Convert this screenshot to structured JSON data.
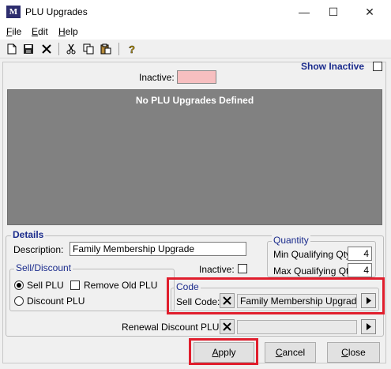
{
  "window": {
    "title": "PLU Upgrades",
    "icon_text": "M",
    "controls": {
      "minimize": "—",
      "maximize": "☐",
      "close": "✕"
    }
  },
  "menu": {
    "items": [
      {
        "label": "File",
        "accel": "F",
        "rest": "ile"
      },
      {
        "label": "Edit",
        "accel": "E",
        "rest": "dit"
      },
      {
        "label": "Help",
        "accel": "H",
        "rest": "elp"
      }
    ]
  },
  "toolbar": {
    "icons": [
      "new-document-icon",
      "save-icon",
      "delete-icon",
      "cut-icon",
      "copy-icon",
      "paste-icon",
      "help-icon"
    ]
  },
  "filters": {
    "show_inactive_label": "Show Inactive",
    "show_inactive_checked": false,
    "inactive_label": "Inactive:",
    "inactive_color": "#f7bfc0"
  },
  "grid": {
    "empty_message": "No PLU Upgrades Defined"
  },
  "details": {
    "label": "Details",
    "description_label": "Description:",
    "description_value": "Family Membership Upgrade",
    "inactive_label": "Inactive:",
    "inactive_checked": false,
    "sell_discount": {
      "label": "Sell/Discount",
      "sell_plu_label": "Sell PLU",
      "remove_old_plu_label": "Remove Old PLU",
      "discount_plu_label": "Discount PLU",
      "selected": "Sell PLU",
      "remove_old_checked": false
    },
    "quantity": {
      "label": "Quantity",
      "min_label": "Min Qualifying Qty:",
      "min_value": "4",
      "max_label": "Max Qualifying Qty:",
      "max_value": "4"
    },
    "code": {
      "label": "Code",
      "sell_code_label": "Sell Code:",
      "sell_code_value": "Family Membership Upgrade"
    },
    "renewal": {
      "label": "Renewal Discount PLU:",
      "value": ""
    }
  },
  "buttons": {
    "apply": {
      "label": "Apply",
      "accel": "A",
      "rest": "pply"
    },
    "cancel": {
      "label": "Cancel",
      "accel": "C",
      "rest": "ancel"
    },
    "close": {
      "label": "Close",
      "accel": "C",
      "rest": "lose"
    }
  },
  "colors": {
    "grid_background": "#818181",
    "group_label": "#1a2b8c",
    "highlight": "#e01e2d"
  }
}
